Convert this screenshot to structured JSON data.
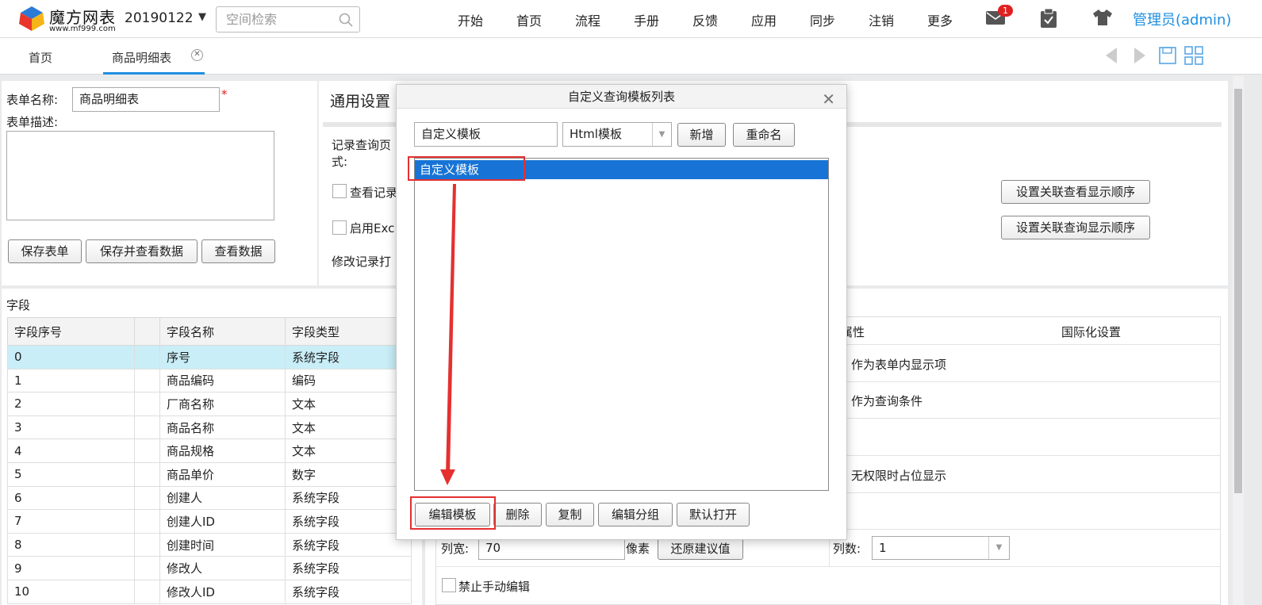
{
  "header": {
    "logo_text": "魔方网表",
    "logo_url": "www.mf999.com",
    "version": "20190122",
    "search_placeholder": "空间检索",
    "nav": [
      "开始",
      "首页",
      "流程",
      "手册",
      "反馈",
      "应用",
      "同步",
      "注销",
      "更多"
    ],
    "mail_badge": "1",
    "user": "管理员(admin)"
  },
  "tabs": {
    "home": "首页",
    "active": "商品明细表"
  },
  "form": {
    "name_label": "表单名称:",
    "name_value": "商品明细表",
    "required_mark": "*",
    "desc_label": "表单描述:",
    "buttons": [
      "保存表单",
      "保存并查看数据",
      "查看数据"
    ]
  },
  "settings": {
    "title": "通用设置",
    "record_query_1": "记录查询页",
    "record_query_2": "式:",
    "view_record": "查看记录",
    "enable_excel": "启用Exc",
    "modify_record": "修改记录打",
    "btn_view_order": "设置关联查看显示顺序",
    "btn_query_order": "设置关联查询显示顺序"
  },
  "fields": {
    "section_label": "字段",
    "columns": [
      "字段序号",
      "",
      "字段名称",
      "字段类型"
    ],
    "rows": [
      [
        "0",
        "",
        "序号",
        "系统字段"
      ],
      [
        "1",
        "",
        "商品编码",
        "编码"
      ],
      [
        "2",
        "",
        "厂商名称",
        "文本"
      ],
      [
        "3",
        "",
        "商品名称",
        "文本"
      ],
      [
        "4",
        "",
        "商品规格",
        "文本"
      ],
      [
        "5",
        "",
        "商品单价",
        "数字"
      ],
      [
        "6",
        "",
        "创建人",
        "系统字段"
      ],
      [
        "7",
        "",
        "创建人ID",
        "系统字段"
      ],
      [
        "8",
        "",
        "创建时间",
        "系统字段"
      ],
      [
        "9",
        "",
        "修改人",
        "系统字段"
      ],
      [
        "10",
        "",
        "修改人ID",
        "系统字段"
      ]
    ]
  },
  "props": {
    "col_attr": "属性",
    "col_i18n": "国际化设置",
    "show_in_form": "作为表单内显示项",
    "as_query": "作为查询条件",
    "no_perm": "无权限时占位显示",
    "width_label": "列宽:",
    "width_value": "70",
    "px_label": "像素",
    "restore_btn": "还原建议值",
    "cols_label": "列数:",
    "cols_value": "1",
    "no_manual": "禁止手动编辑"
  },
  "dialog": {
    "title": "自定义查询模板列表",
    "name_value": "自定义模板",
    "type_value": "Html模板",
    "btn_add": "新增",
    "btn_rename": "重命名",
    "list_item": "自定义模板",
    "footer_buttons": [
      "编辑模板",
      "删除",
      "复制",
      "编辑分组",
      "默认打开"
    ]
  },
  "colors": {
    "accent": "#1e8fe1",
    "selection": "#1774d6",
    "annotation": "#e53030"
  }
}
